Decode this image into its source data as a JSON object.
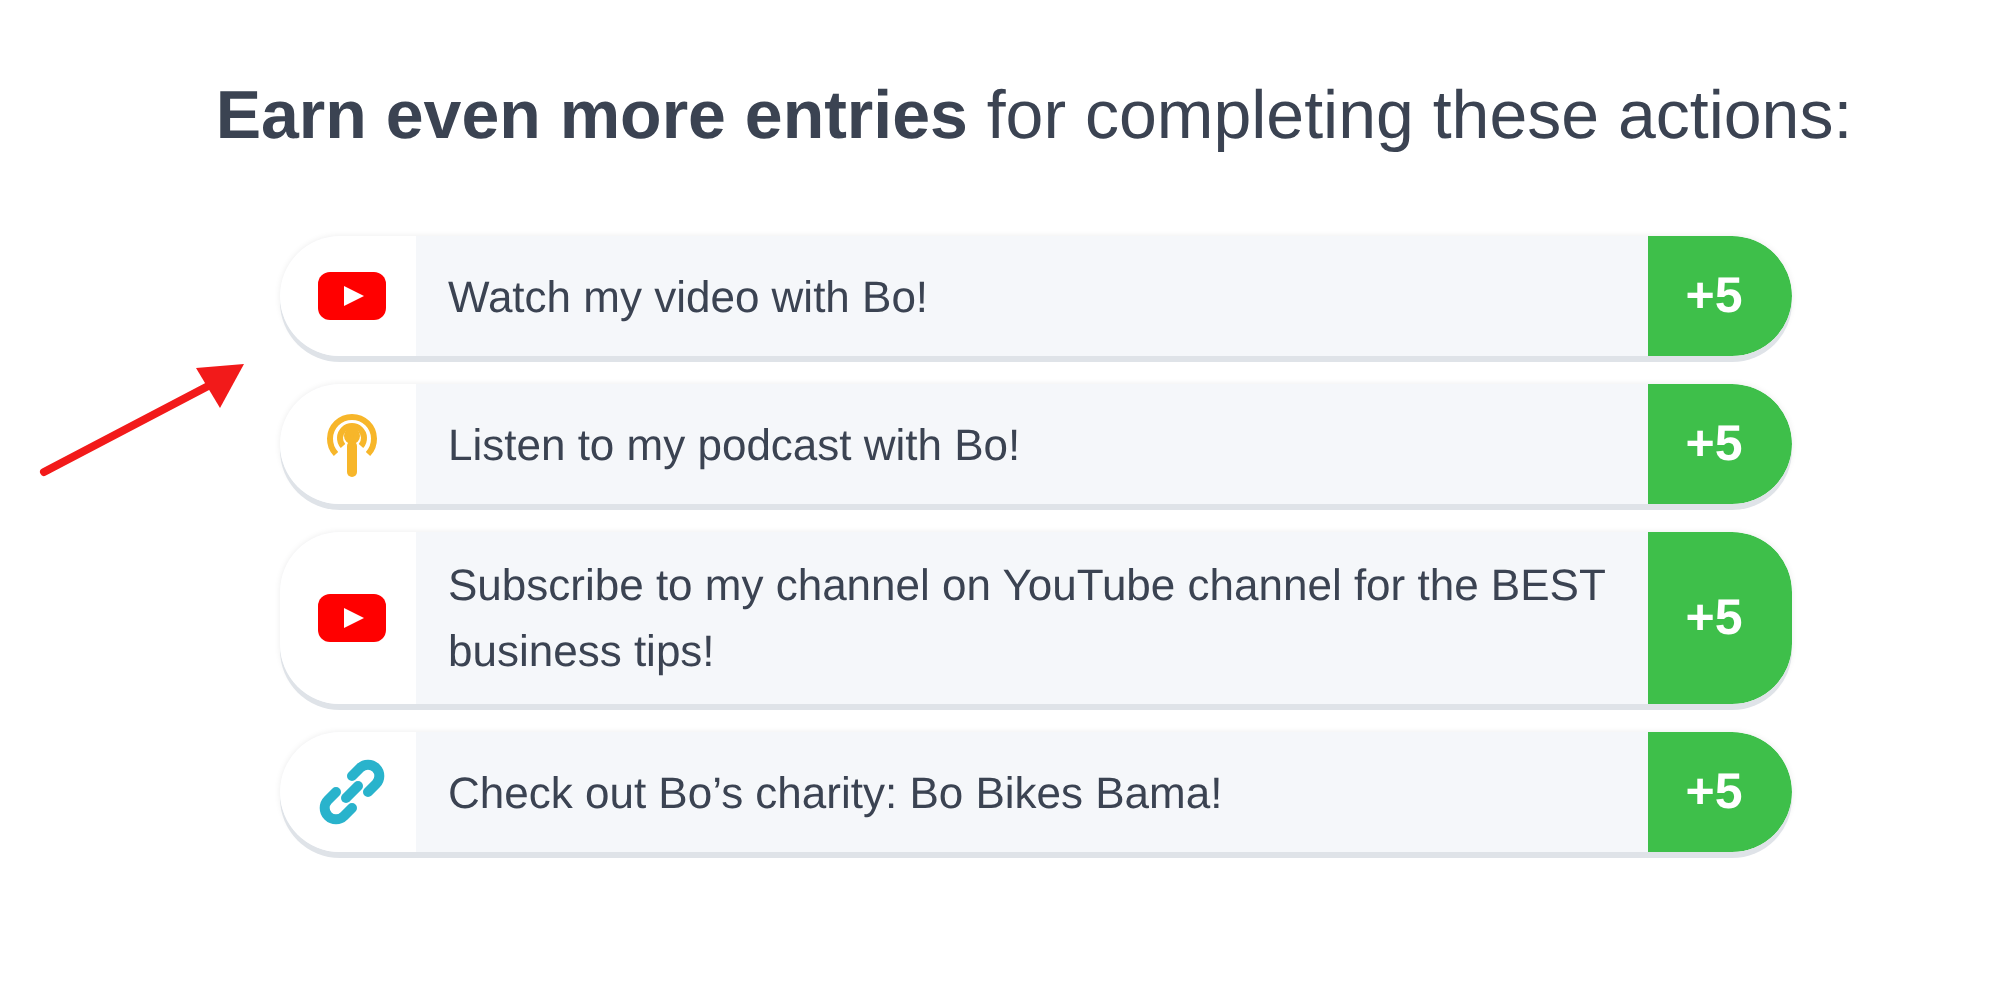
{
  "heading": "**Earn even more entries** for completing these actions:",
  "actions": [
    {
      "kind": "youtube",
      "label": "Watch my video with Bo!",
      "points": "+5"
    },
    {
      "kind": "podcast",
      "label": "Listen to my podcast with Bo!",
      "points": "+5"
    },
    {
      "kind": "youtube",
      "label": "Subscribe to my channel on YouTube channel for the BEST business tips!",
      "points": "+5"
    },
    {
      "kind": "link",
      "label": "Check out Bo’s charity: Bo Bikes Bama!",
      "points": "+5"
    }
  ]
}
